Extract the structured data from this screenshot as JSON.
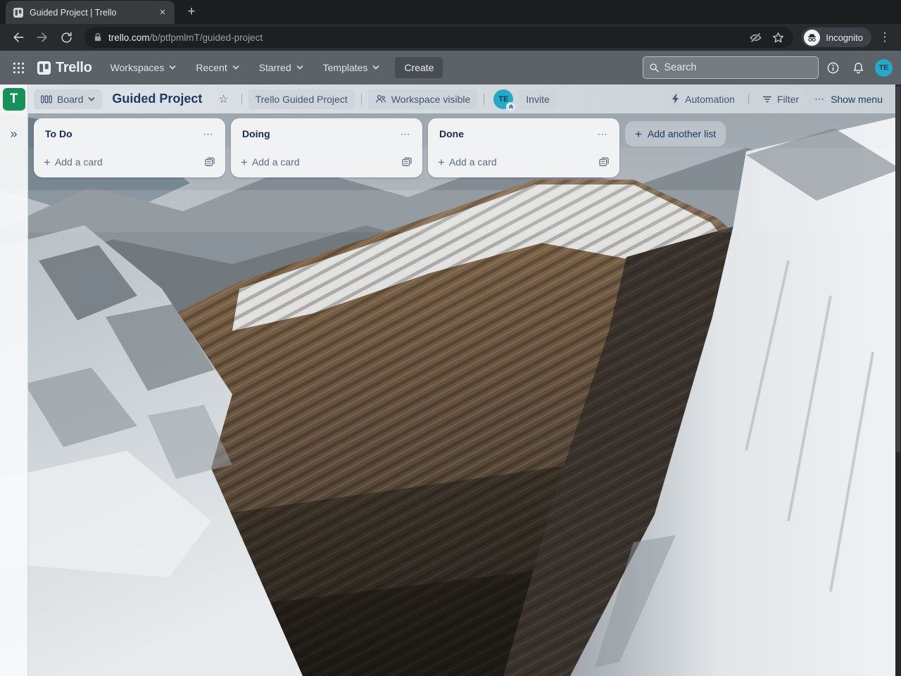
{
  "browser": {
    "tab_title": "Guided Project | Trello",
    "close_tab_icon": "×",
    "new_tab_icon": "+",
    "url_domain": "trello.com",
    "url_path": "/b/ptfpmlmT/guided-project",
    "incognito_label": "Incognito",
    "menu_icon": "⋮"
  },
  "nav": {
    "logo_text": "Trello",
    "menu_workspaces": "Workspaces",
    "menu_recent": "Recent",
    "menu_starred": "Starred",
    "menu_templates": "Templates",
    "create_label": "Create",
    "search_placeholder": "Search",
    "avatar_initials": "TE"
  },
  "sidebar": {
    "workspace_initial": "T",
    "expand_icon": "»"
  },
  "board_header": {
    "view_label": "Board",
    "title": "Guided Project",
    "star_icon": "☆",
    "workspace_name": "Trello Guided Project",
    "visibility_label": "Workspace visible",
    "member_initials": "TE",
    "invite_label": "Invite",
    "automation_label": "Automation",
    "filter_label": "Filter",
    "menu_icon": "⋯",
    "show_menu_label": "Show menu"
  },
  "lists": {
    "items": [
      {
        "title": "To Do"
      },
      {
        "title": "Doing"
      },
      {
        "title": "Done"
      }
    ],
    "menu_icon": "⋯",
    "plus_icon": "+",
    "add_card_label": "Add a card",
    "add_list_label": "Add another list"
  },
  "colors": {
    "avatar_teal": "#27a8c6",
    "workspace_green": "#17915a",
    "nav_gray": "#5b6268",
    "list_bg": "#f1f2f4",
    "title_navy": "#1d3a5f"
  }
}
